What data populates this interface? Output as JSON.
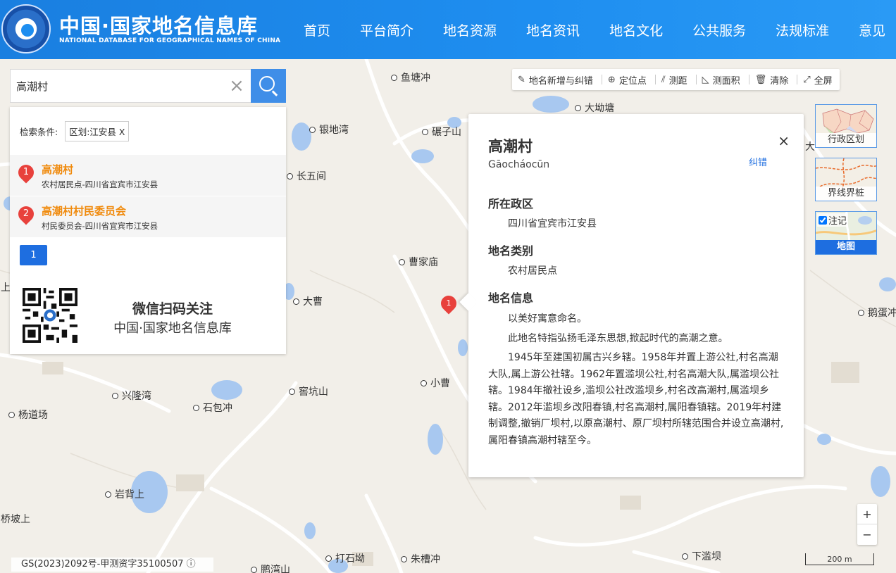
{
  "header": {
    "title_cn": "中国·国家地名信息库",
    "title_en": "NATIONAL DATABASE FOR GEOGRAPHICAL NAMES OF CHINA",
    "nav": [
      "首页",
      "平台简介",
      "地名资源",
      "地名资讯",
      "地名文化",
      "公共服务",
      "法规标准",
      "意见"
    ]
  },
  "search": {
    "value": "高潮村",
    "clear": "×"
  },
  "results": {
    "condition_label": "检索条件:",
    "condition_tag": "区划:江安县 X",
    "items": [
      {
        "index": "1",
        "name": "高潮村",
        "sub": "农村居民点-四川省宜宾市江安县"
      },
      {
        "index": "2",
        "name": "高潮村村民委员会",
        "sub": "村民委员会-四川省宜宾市江安县"
      }
    ],
    "page": "1",
    "wechat_title": "微信扫码关注",
    "wechat_sub": "中国·国家地名信息库"
  },
  "toolbar": {
    "items": [
      {
        "icon": "edit-icon",
        "glyph": "✎",
        "label": "地名新增与纠错"
      },
      {
        "icon": "locate-icon",
        "glyph": "⊕",
        "label": "定位点"
      },
      {
        "icon": "ruler-icon",
        "glyph": "⫽",
        "label": "测距"
      },
      {
        "icon": "area-icon",
        "glyph": "◺",
        "label": "测面积"
      },
      {
        "icon": "trash-icon",
        "glyph": "🗑",
        "label": "清除"
      },
      {
        "icon": "fullscreen-icon",
        "glyph": "⤢",
        "label": "全屏"
      }
    ]
  },
  "popup": {
    "title": "高潮村",
    "pinyin": "Gāocháocūn",
    "correct": "纠错",
    "close": "×",
    "sections": [
      {
        "title": "所在政区",
        "text": "四川省宜宾市江安县"
      },
      {
        "title": "地名类别",
        "text": "农村居民点"
      }
    ],
    "info_title": "地名信息",
    "info_paragraphs": [
      "以美好寓意命名。",
      "此地名特指弘扬毛泽东思想,掀起时代的高潮之意。",
      "1945年至建国初属古兴乡辖。1958年并置上游公社,村名高潮大队,属上游公社辖。1962年置滥坝公社,村名高潮大队,属滥坝公社辖。1984年撤社设乡,滥坝公社改滥坝乡,村名改高潮村,属滥坝乡辖。2012年滥坝乡改阳春镇,村名高潮村,属阳春镇辖。2019年村建制调整,撤销厂坝村,以原高潮村、原厂坝村所辖范围合并设立高潮村,属阳春镇高潮村辖至今。"
    ]
  },
  "map_pin": "1",
  "layers": [
    {
      "label": "行政区划"
    },
    {
      "label": "界线界桩"
    },
    {
      "label": "地图",
      "check_label": "注记"
    }
  ],
  "zoom": {
    "in": "+",
    "out": "−"
  },
  "copyright": "GS(2023)2092号-甲测资字35100507 ⓘ",
  "scale": "200 m",
  "places": [
    "鱼塘冲",
    "大坳塘",
    "银地湾",
    "碾子山",
    "长五间",
    "曹家庙",
    "大曹",
    "小曹",
    "窖坑山",
    "兴隆湾",
    "石包冲",
    "杨道场",
    "岩背上",
    "桥坡上",
    "打石坳",
    "朱槽冲",
    "下滥坝",
    "鹅蛋冲",
    "鹏湾山",
    "上",
    "大"
  ]
}
